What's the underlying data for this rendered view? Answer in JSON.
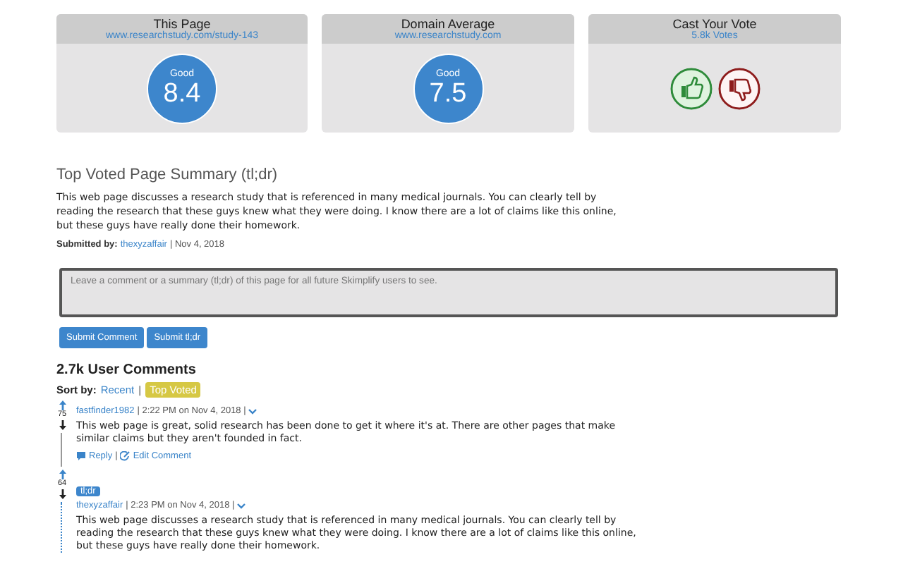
{
  "cards": [
    {
      "kind": "score",
      "title": "This Page",
      "subtitle": "www.researchstudy.com/study-143",
      "rating_label": "Good",
      "score": "8.4"
    },
    {
      "kind": "score",
      "title": "Domain Average",
      "subtitle": "www.researchstudy.com",
      "rating_label": "Good",
      "score": "7.5"
    },
    {
      "kind": "vote",
      "title": "Cast Your Vote",
      "subtitle": "5.8k Votes"
    }
  ],
  "summary": {
    "heading": "Top Voted Page Summary (tl;dr)",
    "text": "This web page discusses a research study that is referenced in many medical journals. You can clearly tell by reading the research that these guys knew what they were doing. I know there are a lot of claims like this online, but these guys have really done their homework.",
    "submitted_label": "Submitted by:",
    "author": "thexyzaffair",
    "date": "| Nov 4, 2018"
  },
  "comment_box": {
    "placeholder": "Leave a comment or a summary (tl;dr) of this page for all future Skimplify users to see."
  },
  "buttons": [
    "Submit Comment",
    "Submit tl;dr"
  ],
  "comments_section": {
    "heading": "2.7k User Comments",
    "sort_label": "Sort by:",
    "separator": "|",
    "sort_options": [
      {
        "label": "Recent",
        "selected": false
      },
      {
        "label": "Top Voted",
        "selected": true
      }
    ],
    "comments": [
      {
        "kind": "comment",
        "votes": "75",
        "author": "fastfinder1982",
        "meta": "| 2:22 PM on Nov 4, 2018 |",
        "text": "This web page is great, solid research has been done to get it where it's at. There are other pages that make similar claims but they aren't founded in fact.",
        "actions": [
          {
            "kind": "reply",
            "label": "Reply"
          },
          {
            "kind": "separator",
            "label": "|"
          },
          {
            "kind": "edit",
            "label": "Edit Comment"
          }
        ]
      },
      {
        "kind": "tldr",
        "badge": "tl;dr",
        "votes": "64",
        "author": "thexyzaffair",
        "meta": "| 2:23 PM on Nov 4, 2018 |",
        "text": "This web page discusses a research study that is referenced in many medical journals. You can clearly tell by reading the research that these guys knew what they were doing. I know there are a lot of claims like this online, but these guys have really done their homework."
      }
    ]
  }
}
